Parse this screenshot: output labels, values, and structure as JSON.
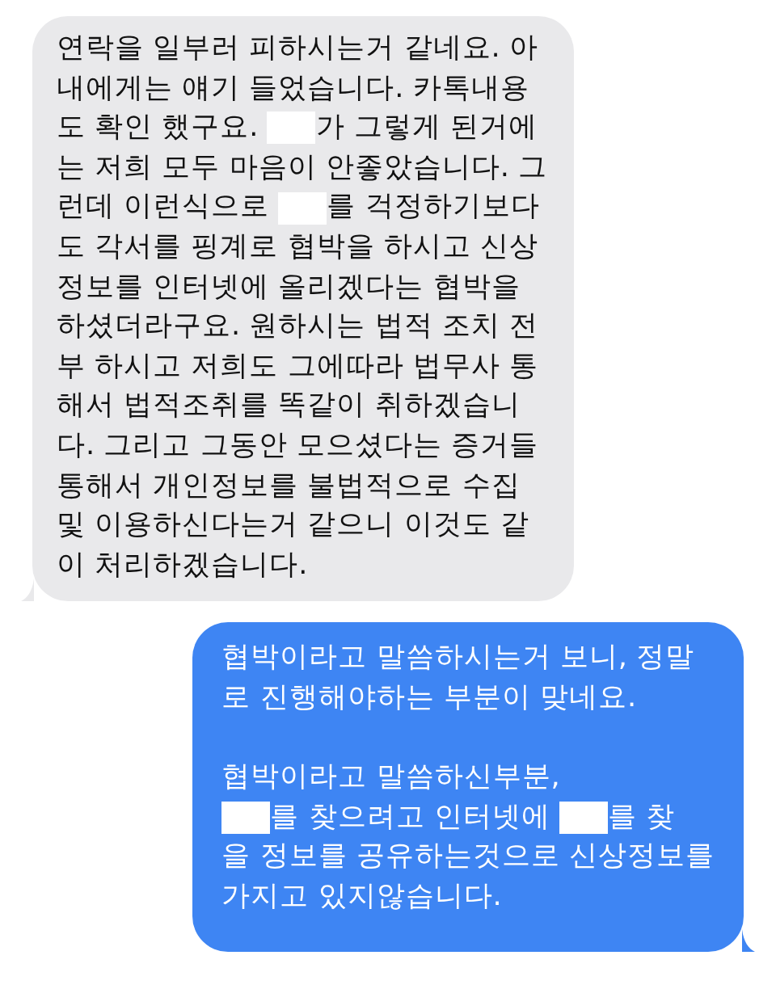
{
  "messages": [
    {
      "kind": "received",
      "paragraphs": [
        {
          "lines": [
            [
              {
                "kind": "text",
                "text": "연락을 일부러 피하시는거 같네요. 아"
              }
            ],
            [
              {
                "kind": "text",
                "text": "내에게는 얘기 들었습니다. 카톡내용"
              }
            ],
            [
              {
                "kind": "text",
                "text": "도 확인 했구요. "
              },
              {
                "kind": "redacted"
              },
              {
                "kind": "text",
                "text": "가 그렇게 된거에"
              }
            ],
            [
              {
                "kind": "text",
                "text": "는 저희 모두 마음이 안좋았습니다. 그"
              }
            ],
            [
              {
                "kind": "text",
                "text": "런데 이런식으로 "
              },
              {
                "kind": "redacted"
              },
              {
                "kind": "text",
                "text": "를 걱정하기보다"
              }
            ],
            [
              {
                "kind": "text",
                "text": "도 각서를 핑계로 협박을 하시고 신상"
              }
            ],
            [
              {
                "kind": "text",
                "text": "정보를 인터넷에 올리겠다는 협박을"
              }
            ],
            [
              {
                "kind": "text",
                "text": "하셨더라구요. 원하시는 법적 조치 전"
              }
            ],
            [
              {
                "kind": "text",
                "text": "부 하시고 저희도 그에따라 법무사 통"
              }
            ],
            [
              {
                "kind": "text",
                "text": "해서 법적조취를 똑같이 취하겠습니"
              }
            ],
            [
              {
                "kind": "text",
                "text": "다. 그리고 그동안 모으셨다는 증거들"
              }
            ],
            [
              {
                "kind": "text",
                "text": "통해서 개인정보를 불법적으로 수집"
              }
            ],
            [
              {
                "kind": "text",
                "text": "및 이용하신다는거 같으니 이것도 같"
              }
            ],
            [
              {
                "kind": "text",
                "text": "이 처리하겠습니다."
              }
            ]
          ]
        }
      ]
    },
    {
      "kind": "sent",
      "paragraphs": [
        {
          "lines": [
            [
              {
                "kind": "text",
                "text": "협박이라고 말씀하시는거 보니, 정말"
              }
            ],
            [
              {
                "kind": "text",
                "text": "로 진행해야하는 부분이 맞네요."
              }
            ]
          ]
        },
        {
          "lines": [
            [
              {
                "kind": "text",
                "text": "협박이라고 말씀하신부분,"
              }
            ],
            [
              {
                "kind": "redacted"
              },
              {
                "kind": "text",
                "text": "를 찾으려고 인터넷에 "
              },
              {
                "kind": "redacted"
              },
              {
                "kind": "text",
                "text": "를 찾"
              }
            ],
            [
              {
                "kind": "text",
                "text": "을 정보를 공유하는것으로 신상정보를"
              }
            ],
            [
              {
                "kind": "text",
                "text": "가지고 있지않습니다."
              }
            ]
          ]
        }
      ]
    }
  ]
}
